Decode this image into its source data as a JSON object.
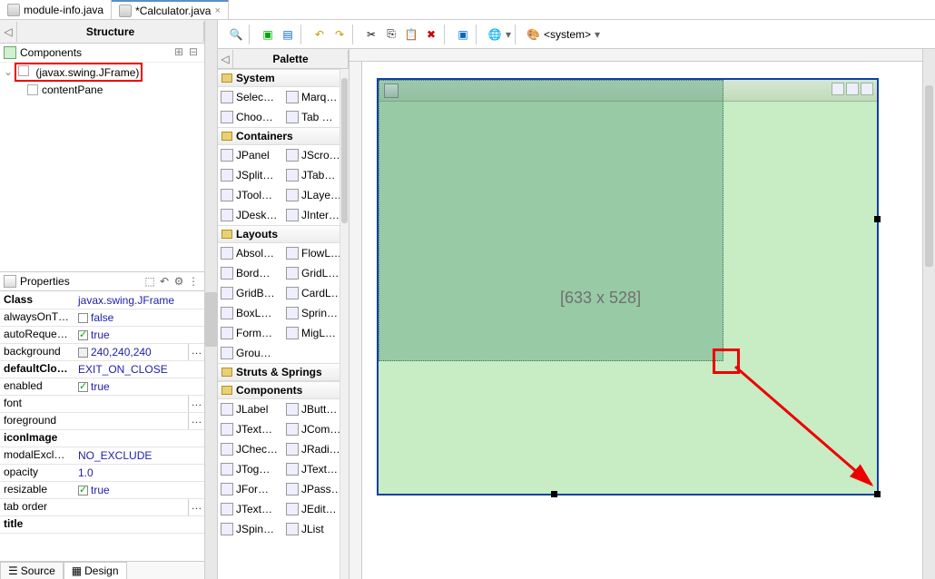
{
  "tabs": {
    "file1": {
      "label": "module-info.java"
    },
    "file2": {
      "label": "*Calculator.java"
    }
  },
  "structure": {
    "title": "Structure",
    "components_label": "Components",
    "tree": {
      "root": "(javax.swing.JFrame)",
      "child": "contentPane"
    }
  },
  "properties": {
    "title": "Properties",
    "rows": {
      "class": {
        "label": "Class",
        "value": "javax.swing.JFrame"
      },
      "alwaysOnTop": {
        "label": "alwaysOnT…",
        "value": "false"
      },
      "autoRequest": {
        "label": "autoReques…",
        "value": "true"
      },
      "background": {
        "label": "background",
        "value": "240,240,240"
      },
      "defaultClose": {
        "label": "defaultClo…",
        "value": "EXIT_ON_CLOSE"
      },
      "enabled": {
        "label": "enabled",
        "value": "true"
      },
      "font": {
        "label": "font",
        "value": ""
      },
      "foreground": {
        "label": "foreground",
        "value": ""
      },
      "iconImage": {
        "label": "iconImage",
        "value": ""
      },
      "modalExclude": {
        "label": "modalExclu…",
        "value": "NO_EXCLUDE"
      },
      "opacity": {
        "label": "opacity",
        "value": "1.0"
      },
      "resizable": {
        "label": "resizable",
        "value": "true"
      },
      "tabOrder": {
        "label": "tab order",
        "value": ""
      },
      "title": {
        "label": "title",
        "value": ""
      }
    }
  },
  "bottomTabs": {
    "source": "Source",
    "design": "Design"
  },
  "toolbar": {
    "system": "<system>"
  },
  "palette": {
    "title": "Palette",
    "sections": {
      "system": {
        "title": "System",
        "items": [
          "Selec…",
          "Marq…",
          "Choo…",
          "Tab …"
        ]
      },
      "containers": {
        "title": "Containers",
        "items": [
          "JPanel",
          "JScro…",
          "JSplit…",
          "JTab…",
          "JTool…",
          "JLaye…",
          "JDesk…",
          "JInter…"
        ]
      },
      "layouts": {
        "title": "Layouts",
        "items": [
          "Absol…",
          "FlowL…",
          "Bord…",
          "GridL…",
          "GridB…",
          "CardL…",
          "BoxL…",
          "Sprin…",
          "Form…",
          "MigL…",
          "Grou…",
          ""
        ]
      },
      "struts": {
        "title": "Struts & Springs"
      },
      "components": {
        "title": "Components",
        "items": [
          "JLabel",
          "JButt…",
          "JText…",
          "JCom…",
          "JChec…",
          "JRadi…",
          "JTog…",
          "JText…",
          "JFor…",
          "JPass…",
          "JText…",
          "JEdit…",
          "JSpin…",
          "JList"
        ]
      }
    }
  },
  "canvas": {
    "sizeLabel": "[633 x 528]"
  }
}
